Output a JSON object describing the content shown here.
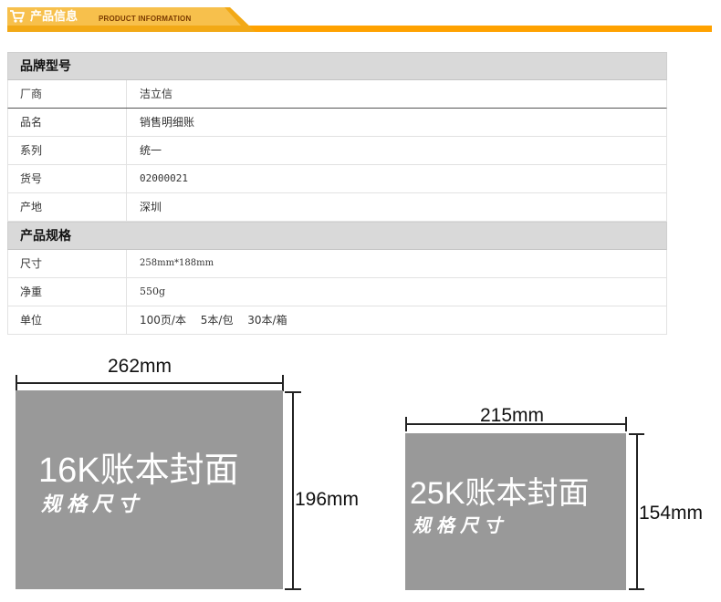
{
  "header": {
    "title": "产品信息",
    "subtitle": "PRODUCT INFORMATION",
    "icon": "cart-icon",
    "accent_color": "#ffa200"
  },
  "brand_section": {
    "title": "品牌型号",
    "rows": [
      {
        "key": "厂商",
        "value": "洁立信"
      },
      {
        "key": "品名",
        "value": "销售明细账"
      },
      {
        "key": "系列",
        "value": "统一"
      },
      {
        "key": "货号",
        "value": "02000021"
      },
      {
        "key": "产地",
        "value": "深圳"
      }
    ]
  },
  "spec_section": {
    "title": "产品规格",
    "rows": [
      {
        "key": "尺寸",
        "value": "258mm*188mm"
      },
      {
        "key": "净重",
        "value": "550g"
      },
      {
        "key": "单位",
        "value": "100页/本　 5本/包　 30本/箱"
      }
    ]
  },
  "diagram_16k": {
    "width_label": "262mm",
    "height_label": "196mm",
    "main_text": "16K账本封面",
    "sub_text": "规格尺寸"
  },
  "diagram_25k": {
    "width_label": "215mm",
    "height_label": "154mm",
    "main_text": "25K账本封面",
    "sub_text": "规格尺寸"
  }
}
